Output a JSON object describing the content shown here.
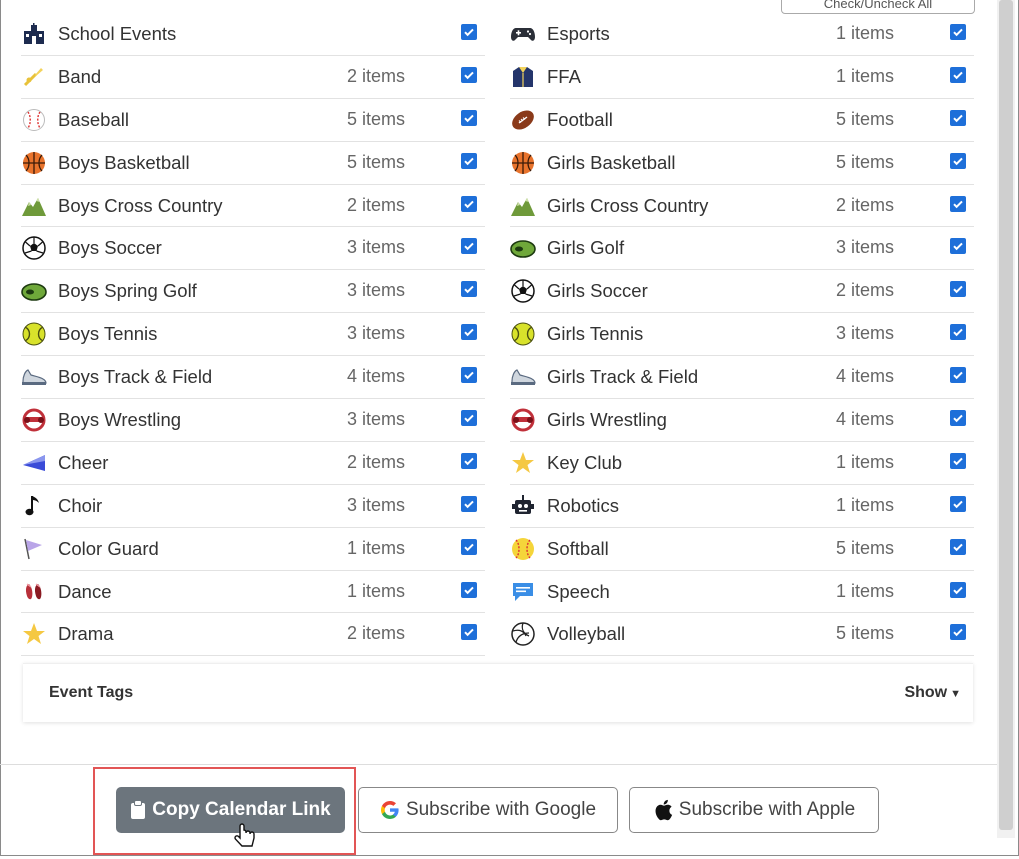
{
  "header": {
    "check_all_label": "Check/Uncheck All"
  },
  "left_column": [
    {
      "name": "School Events",
      "count": "",
      "icon": "school-icon"
    },
    {
      "name": "Band",
      "count": "2 items",
      "icon": "trumpet-icon"
    },
    {
      "name": "Baseball",
      "count": "5 items",
      "icon": "baseball-icon"
    },
    {
      "name": "Boys Basketball",
      "count": "5 items",
      "icon": "basketball-icon"
    },
    {
      "name": "Boys Cross Country",
      "count": "2 items",
      "icon": "mountain-icon"
    },
    {
      "name": "Boys Soccer",
      "count": "3 items",
      "icon": "soccer-ball-icon"
    },
    {
      "name": "Boys Spring Golf",
      "count": "3 items",
      "icon": "golf-green-icon"
    },
    {
      "name": "Boys Tennis",
      "count": "3 items",
      "icon": "tennis-ball-icon"
    },
    {
      "name": "Boys Track & Field",
      "count": "4 items",
      "icon": "running-shoe-icon"
    },
    {
      "name": "Boys Wrestling",
      "count": "3 items",
      "icon": "wrestling-headgear-icon"
    },
    {
      "name": "Cheer",
      "count": "2 items",
      "icon": "megaphone-icon"
    },
    {
      "name": "Choir",
      "count": "3 items",
      "icon": "music-note-icon"
    },
    {
      "name": "Color Guard",
      "count": "1 items",
      "icon": "flag-icon"
    },
    {
      "name": "Dance",
      "count": "1 items",
      "icon": "ballet-shoes-icon"
    },
    {
      "name": "Drama",
      "count": "2 items",
      "icon": "star-icon"
    }
  ],
  "right_column": [
    {
      "name": "Esports",
      "count": "1 items",
      "icon": "gamepad-icon"
    },
    {
      "name": "FFA",
      "count": "1 items",
      "icon": "jacket-icon"
    },
    {
      "name": "Football",
      "count": "5 items",
      "icon": "football-icon"
    },
    {
      "name": "Girls Basketball",
      "count": "5 items",
      "icon": "basketball-icon"
    },
    {
      "name": "Girls Cross Country",
      "count": "2 items",
      "icon": "mountain-icon"
    },
    {
      "name": "Girls Golf",
      "count": "3 items",
      "icon": "golf-green-icon"
    },
    {
      "name": "Girls Soccer",
      "count": "2 items",
      "icon": "soccer-ball-icon"
    },
    {
      "name": "Girls Tennis",
      "count": "3 items",
      "icon": "tennis-ball-icon"
    },
    {
      "name": "Girls Track & Field",
      "count": "4 items",
      "icon": "running-shoe-icon"
    },
    {
      "name": "Girls Wrestling",
      "count": "4 items",
      "icon": "wrestling-headgear-icon"
    },
    {
      "name": "Key Club",
      "count": "1 items",
      "icon": "star-icon"
    },
    {
      "name": "Robotics",
      "count": "1 items",
      "icon": "robot-icon"
    },
    {
      "name": "Softball",
      "count": "5 items",
      "icon": "softball-icon"
    },
    {
      "name": "Speech",
      "count": "1 items",
      "icon": "speech-bubble-icon"
    },
    {
      "name": "Volleyball",
      "count": "5 items",
      "icon": "volleyball-icon"
    }
  ],
  "event_tags": {
    "title": "Event Tags",
    "toggle_label": "Show"
  },
  "buttons": {
    "copy_link": "Copy Calendar Link",
    "google": "Subscribe with Google",
    "apple": "Subscribe with Apple"
  },
  "colors": {
    "checkbox": "#1e6fd9",
    "copy_button": "#6c757d",
    "highlight": "#e25555"
  }
}
